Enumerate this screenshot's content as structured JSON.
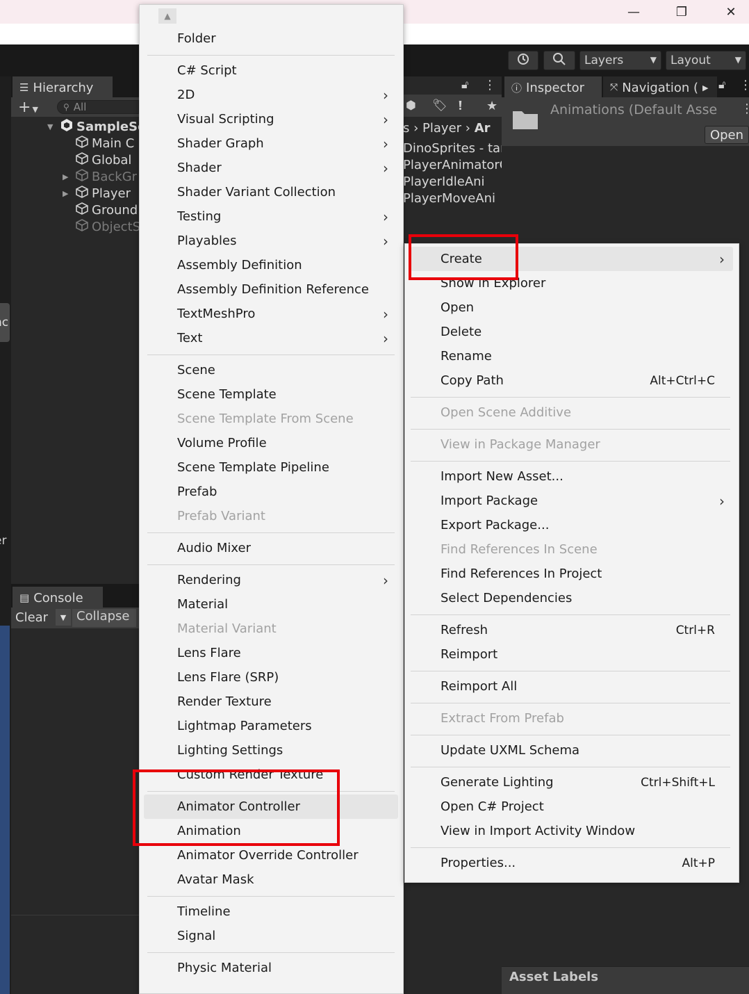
{
  "window": {
    "minimize": "—",
    "maximize": "❐",
    "close": "✕"
  },
  "toolbar": {
    "layers": "Layers",
    "layout": "Layout"
  },
  "hierarchy": {
    "tab": "Hierarchy",
    "search": "All",
    "scene": "SampleSc",
    "items": [
      "Main C",
      "Global",
      "BackGr",
      "Player",
      "Ground",
      "ObjectS"
    ]
  },
  "project": {
    "breadcrumb": [
      "s",
      "Player",
      "Ar"
    ],
    "items": [
      "DinoSprites - tar",
      "PlayerAnimatorC",
      "PlayerIdleAni",
      "PlayerMoveAni"
    ]
  },
  "inspector": {
    "tab_inspector": "Inspector",
    "tab_navigation": "Navigation (",
    "asset_title": "Animations (Default Asse",
    "open_button": "Open",
    "asset_labels": "Asset Labels"
  },
  "console": {
    "tab": "Console",
    "clear": "Clear",
    "collapse": "Collapse"
  },
  "side_fragments": {
    "a": "nc",
    "b": "er"
  },
  "create_menu": {
    "groups": [
      [
        {
          "label": "Folder"
        }
      ],
      [
        {
          "label": "C# Script"
        },
        {
          "label": "2D",
          "submenu": true
        },
        {
          "label": "Visual Scripting",
          "submenu": true
        },
        {
          "label": "Shader Graph",
          "submenu": true
        },
        {
          "label": "Shader",
          "submenu": true
        },
        {
          "label": "Shader Variant Collection"
        },
        {
          "label": "Testing",
          "submenu": true
        },
        {
          "label": "Playables",
          "submenu": true
        },
        {
          "label": "Assembly Definition"
        },
        {
          "label": "Assembly Definition Reference"
        },
        {
          "label": "TextMeshPro",
          "submenu": true
        },
        {
          "label": "Text",
          "submenu": true
        }
      ],
      [
        {
          "label": "Scene"
        },
        {
          "label": "Scene Template"
        },
        {
          "label": "Scene Template From Scene",
          "disabled": true
        },
        {
          "label": "Volume Profile"
        },
        {
          "label": "Scene Template Pipeline"
        },
        {
          "label": "Prefab"
        },
        {
          "label": "Prefab Variant",
          "disabled": true
        }
      ],
      [
        {
          "label": "Audio Mixer"
        }
      ],
      [
        {
          "label": "Rendering",
          "submenu": true
        },
        {
          "label": "Material"
        },
        {
          "label": "Material Variant",
          "disabled": true
        },
        {
          "label": "Lens Flare"
        },
        {
          "label": "Lens Flare (SRP)"
        },
        {
          "label": "Render Texture"
        },
        {
          "label": "Lightmap Parameters"
        },
        {
          "label": "Lighting Settings"
        },
        {
          "label": "Custom Render Texture"
        }
      ],
      [
        {
          "label": "Animator Controller",
          "highlighted": true
        },
        {
          "label": "Animation"
        },
        {
          "label": "Animator Override Controller"
        },
        {
          "label": "Avatar Mask"
        }
      ],
      [
        {
          "label": "Timeline"
        },
        {
          "label": "Signal"
        }
      ],
      [
        {
          "label": "Physic Material"
        }
      ]
    ]
  },
  "context_menu": {
    "groups": [
      [
        {
          "label": "Create",
          "submenu": true,
          "highlighted": true
        },
        {
          "label": "Show in Explorer"
        },
        {
          "label": "Open"
        },
        {
          "label": "Delete"
        },
        {
          "label": "Rename"
        },
        {
          "label": "Copy Path",
          "shortcut": "Alt+Ctrl+C"
        }
      ],
      [
        {
          "label": "Open Scene Additive",
          "disabled": true
        }
      ],
      [
        {
          "label": "View in Package Manager",
          "disabled": true
        }
      ],
      [
        {
          "label": "Import New Asset..."
        },
        {
          "label": "Import Package",
          "submenu": true
        },
        {
          "label": "Export Package..."
        },
        {
          "label": "Find References In Scene",
          "disabled": true
        },
        {
          "label": "Find References In Project"
        },
        {
          "label": "Select Dependencies"
        }
      ],
      [
        {
          "label": "Refresh",
          "shortcut": "Ctrl+R"
        },
        {
          "label": "Reimport"
        }
      ],
      [
        {
          "label": "Reimport All"
        }
      ],
      [
        {
          "label": "Extract From Prefab",
          "disabled": true
        }
      ],
      [
        {
          "label": "Update UXML Schema"
        }
      ],
      [
        {
          "label": "Generate Lighting",
          "shortcut": "Ctrl+Shift+L"
        },
        {
          "label": "Open C# Project"
        },
        {
          "label": "View in Import Activity Window"
        }
      ],
      [
        {
          "label": "Properties...",
          "shortcut": "Alt+P"
        }
      ]
    ]
  },
  "colors": {
    "highlight_box": "#e8000a",
    "menu_bg": "#f3f3f3",
    "editor_bg": "#282828"
  }
}
